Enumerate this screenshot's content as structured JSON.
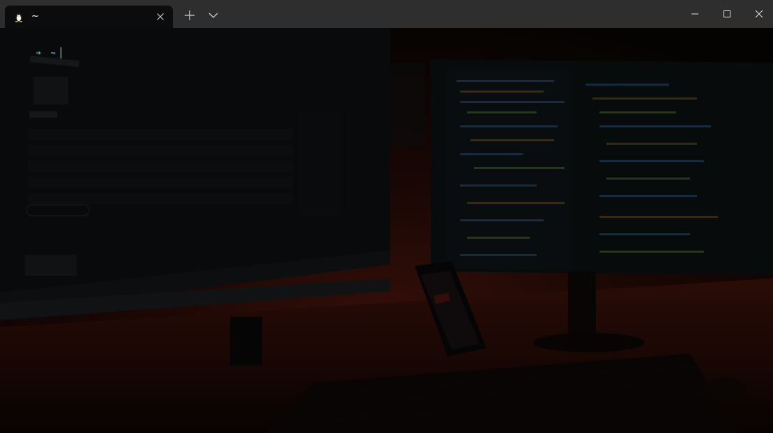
{
  "tab": {
    "title": "~",
    "icon": "linux-tux-icon"
  },
  "toolbar": {
    "new_tab_icon": "plus-icon",
    "dropdown_icon": "chevron-down-icon"
  },
  "window_controls": {
    "minimize_icon": "minimize-icon",
    "maximize_icon": "maximize-icon",
    "close_icon": "close-icon"
  },
  "terminal": {
    "prompt_symbol": "➜",
    "current_dir": "~",
    "background_image": "dimmed photo of a dual-monitor desk setup with red ambient lighting"
  },
  "colors": {
    "titlebar": "#2e2e2e",
    "tab_active": "#0c0c0c",
    "prompt_arrow": "#23d18b",
    "prompt_dir": "#29b8db",
    "ambient_red": "#5a1a10"
  }
}
